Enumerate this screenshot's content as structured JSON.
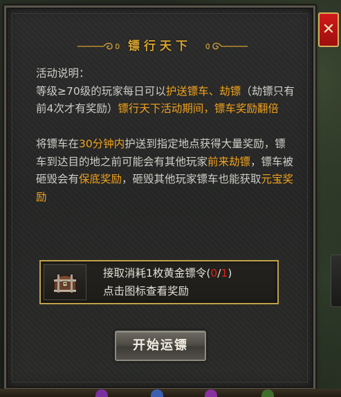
{
  "dialog": {
    "title": "镖行天下",
    "close_label": "✕"
  },
  "description": {
    "heading": "活动说明：",
    "p1_parts": [
      {
        "text": "等级≥70级的玩家每日可以",
        "hl": false
      },
      {
        "text": "护送镖车、劫镖",
        "hl": true
      },
      {
        "text": "（劫镖只有前4次才有奖励）",
        "hl": false
      },
      {
        "text": "镖行天下活动期间，镖车奖励翻倍",
        "hl": true
      }
    ],
    "p2_parts": [
      {
        "text": "将镖车在",
        "hl": false
      },
      {
        "text": "30分钟内",
        "hl": true
      },
      {
        "text": "护送到指定地点获得大量奖励，镖车到达目的地之前可能会有其他玩家",
        "hl": false
      },
      {
        "text": "前来劫镖",
        "hl": true
      },
      {
        "text": "，镖车被砸毁会有",
        "hl": false
      },
      {
        "text": "保底奖励",
        "hl": true
      },
      {
        "text": "，砸毁其他玩家镖车也能获取",
        "hl": false
      },
      {
        "text": "元宝奖励",
        "hl": true
      }
    ]
  },
  "task": {
    "cost_prefix": "接取消耗1枚黄金镖令(",
    "count_used": "0",
    "count_sep": "/",
    "count_total": "1",
    "cost_suffix": ")",
    "hint": "点击图标查看奖励",
    "icon": "treasure-chest-icon"
  },
  "actions": {
    "start_label": "开始运镖"
  },
  "colors": {
    "title": "#d8a431",
    "highlight": "#f1a21c",
    "count_red": "#e2221b",
    "body_text": "#cfcfc9",
    "task_border": "#c2a24a",
    "close_bg": "#c51414"
  }
}
